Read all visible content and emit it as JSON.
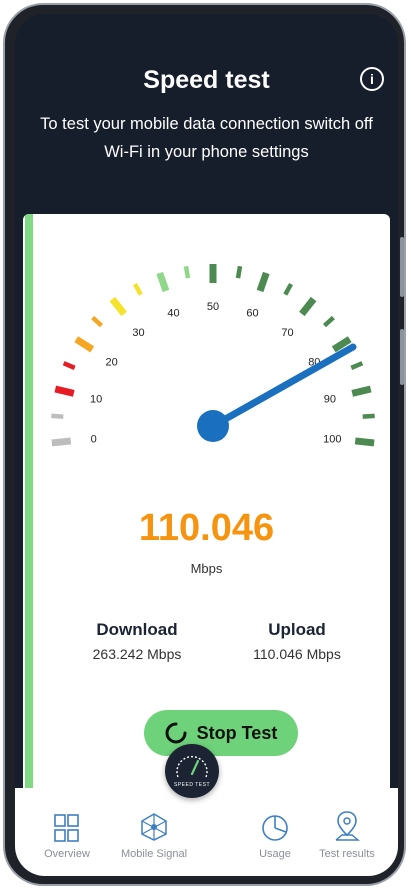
{
  "header": {
    "title": "Speed test",
    "subtitle": "To test your mobile data connection switch off Wi-Fi in your phone settings"
  },
  "gauge": {
    "scale_labels": [
      "0",
      "10",
      "20",
      "30",
      "40",
      "50",
      "60",
      "70",
      "80",
      "90",
      "100"
    ],
    "current_value": 110.046,
    "colors": {
      "low": "#bdbdbd",
      "red": "#e51c23",
      "orange": "#f5a623",
      "yellow": "#f5e22a",
      "lightgreen": "#8fd88a",
      "green": "#4c8a52",
      "needle": "#1b6fbf"
    }
  },
  "result": {
    "speed": "110.046",
    "unit": "Mbps"
  },
  "stats": {
    "download_label": "Download",
    "download_value": "263.242 Mbps",
    "upload_label": "Upload",
    "upload_value": "110.046 Mbps"
  },
  "actions": {
    "stop_label": "Stop Test"
  },
  "fab": {
    "label": "SPEED TEST"
  },
  "background_text": "download",
  "nav": {
    "items": [
      {
        "label": "Overview",
        "icon": "grid-icon"
      },
      {
        "label": "Mobile Signal",
        "icon": "network-icon"
      },
      {
        "label": "Usage",
        "icon": "pie-chart-icon"
      },
      {
        "label": "Test results",
        "icon": "map-pin-icon"
      }
    ]
  }
}
